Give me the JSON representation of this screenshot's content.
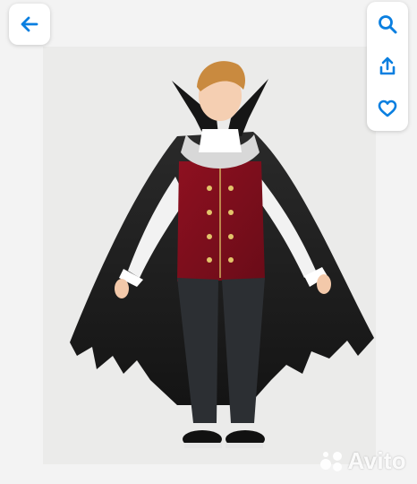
{
  "watermark": {
    "text": "Avito"
  },
  "icons": {
    "back": "arrow-left-icon",
    "search": "search-icon",
    "share": "share-icon",
    "favorite": "heart-icon"
  },
  "colors": {
    "accent": "#0a7fe0",
    "background": "#f3f3f3"
  }
}
